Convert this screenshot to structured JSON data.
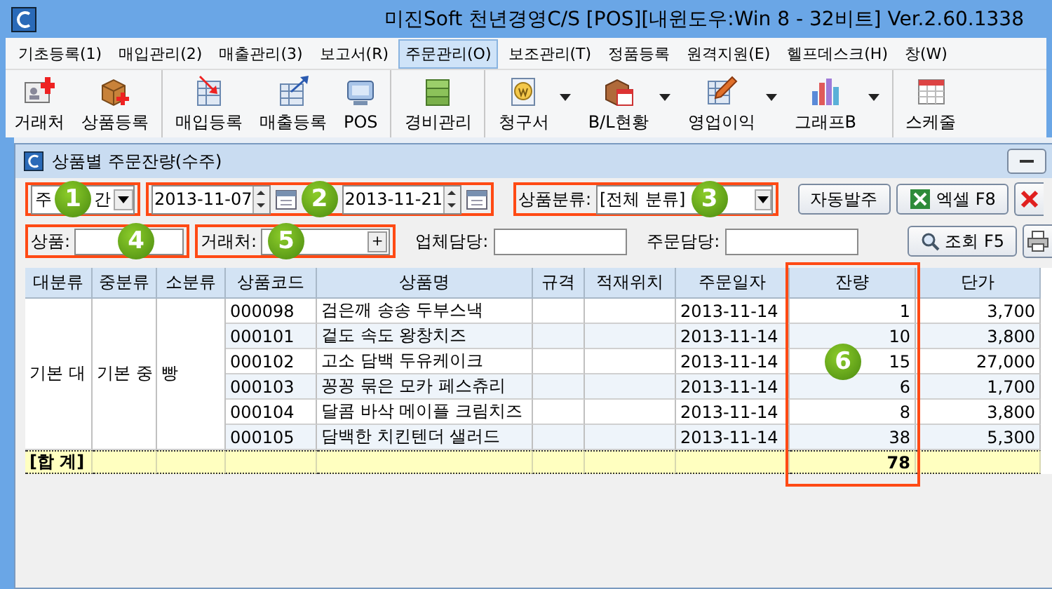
{
  "app_title": "미진Soft 천년경영C/S [POS][내윈도우:Win 8 - 32비트] Ver.2.60.1338",
  "menu": [
    {
      "label": "기초등록(1)",
      "selected": false
    },
    {
      "label": "매입관리(2)",
      "selected": false
    },
    {
      "label": "매출관리(3)",
      "selected": false
    },
    {
      "label": "보고서(R)",
      "selected": false
    },
    {
      "label": "주문관리(O)",
      "selected": true
    },
    {
      "label": "보조관리(T)",
      "selected": false
    },
    {
      "label": "정품등록",
      "selected": false
    },
    {
      "label": "원격지원(E)",
      "selected": false
    },
    {
      "label": "헬프데스크(H)",
      "selected": false
    },
    {
      "label": "창(W)",
      "selected": false
    }
  ],
  "toolbar": [
    {
      "label": "거래처",
      "kind": "card",
      "dropdown": false,
      "separator_before": false
    },
    {
      "label": "상품등록",
      "kind": "box",
      "dropdown": false,
      "separator_before": false
    },
    {
      "label": "매입등록",
      "kind": "doc_in",
      "dropdown": false,
      "separator_before": true
    },
    {
      "label": "매출등록",
      "kind": "doc_out",
      "dropdown": false,
      "separator_before": false
    },
    {
      "label": "POS",
      "kind": "monitor",
      "dropdown": false,
      "separator_before": false
    },
    {
      "label": "경비관리",
      "kind": "money",
      "dropdown": false,
      "separator_before": true
    },
    {
      "label": "청구서",
      "kind": "invoice",
      "dropdown": true,
      "separator_before": true
    },
    {
      "label": "B/L현황",
      "kind": "calendar_box",
      "dropdown": true,
      "separator_before": false
    },
    {
      "label": "영업이익",
      "kind": "pencil_doc",
      "dropdown": true,
      "separator_before": false
    },
    {
      "label": "그래프B",
      "kind": "bars",
      "dropdown": true,
      "separator_before": false
    },
    {
      "label": "스케줄",
      "kind": "calendar",
      "dropdown": false,
      "separator_before": true
    }
  ],
  "window": {
    "title": "상품별 주문잔량(수주)"
  },
  "filters": {
    "period_visible_text": [
      "주",
      "간"
    ],
    "start_date": "2013-11-07",
    "end_date": "2013-11-21",
    "category_label": "상품분류:",
    "category_value": "[전체 분류]",
    "buttons": [
      {
        "label": "자동발주",
        "kind": "plain"
      },
      {
        "label": "엑셀 F8",
        "kind": "excel"
      }
    ],
    "fields": [
      {
        "label": "상품:",
        "kind": "text"
      },
      {
        "label": "거래처:",
        "kind": "lookup",
        "lookup_button": "+"
      },
      {
        "label": "업체담당:",
        "kind": "text"
      },
      {
        "label": "주문담당:",
        "kind": "text"
      }
    ],
    "search_button": "조회 F5"
  },
  "callouts": [
    "1",
    "2",
    "3",
    "4",
    "5",
    "6"
  ],
  "table": {
    "columns": [
      "대분류",
      "중분류",
      "소분류",
      "상품코드",
      "상품명",
      "규격",
      "적재위치",
      "주문일자",
      "잔량",
      "단가"
    ],
    "group": [
      "기본 대",
      "기본 중",
      "빵"
    ],
    "rows": [
      {
        "code": "000098",
        "name": "검은깨 송송 두부스낵",
        "date": "2013-11-14",
        "qty": "1",
        "price": "3,700"
      },
      {
        "code": "000101",
        "name": "겉도 속도 왕창치즈",
        "date": "2013-11-14",
        "qty": "10",
        "price": "3,800"
      },
      {
        "code": "000102",
        "name": "고소 담백 두유케이크",
        "date": "2013-11-14",
        "qty": "15",
        "price": "27,000"
      },
      {
        "code": "000103",
        "name": "꽁꽁 묶은 모카 페스츄리",
        "date": "2013-11-14",
        "qty": "6",
        "price": "1,700"
      },
      {
        "code": "000104",
        "name": "달콤 바삭 메이플 크림치즈",
        "date": "2013-11-14",
        "qty": "8",
        "price": "3,800"
      },
      {
        "code": "000105",
        "name": "담백한 치킨텐더 샐러드",
        "date": "2013-11-14",
        "qty": "38",
        "price": "5,300"
      }
    ],
    "total": {
      "label": "[합 계]",
      "qty": "78"
    }
  }
}
